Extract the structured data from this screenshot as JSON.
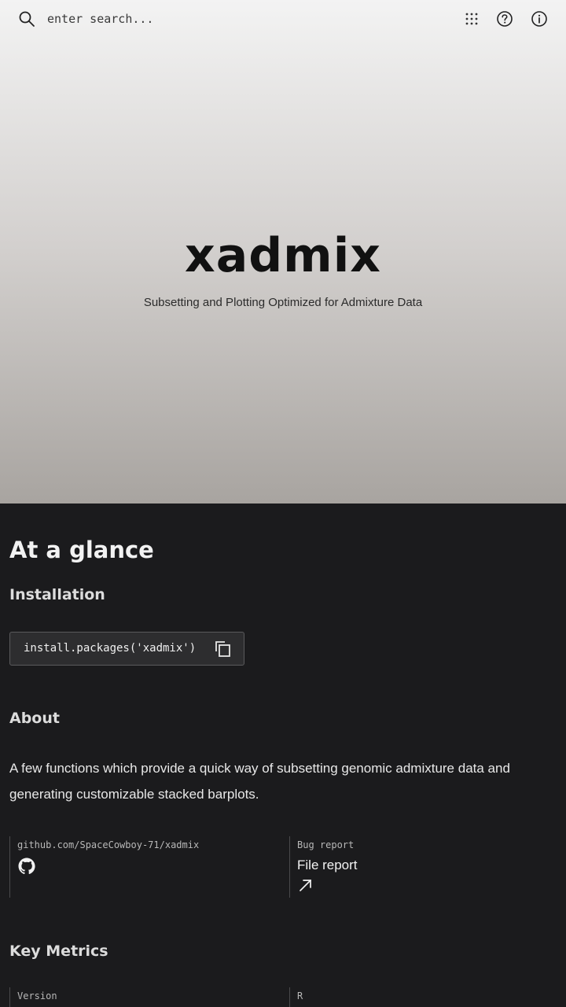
{
  "search": {
    "placeholder": "enter search..."
  },
  "header_icons": [
    "search-icon",
    "apps-grid-icon",
    "help-icon",
    "info-icon"
  ],
  "hero": {
    "title": "xadmix",
    "subtitle": "Subsetting and Plotting Optimized for Admixture Data"
  },
  "glance": {
    "heading": "At a glance",
    "installation": {
      "heading": "Installation",
      "code": "install.packages('xadmix')",
      "icon": "copy-icon"
    },
    "about": {
      "heading": "About",
      "text": "A few functions which provide a quick way of subsetting genomic admixture data and generating customizable stacked barplots."
    },
    "links": {
      "repo_label": "github.com/SpaceCowboy-71/xadmix",
      "repo_icon": "github-icon",
      "bug_label": "Bug report",
      "bug_link": "File report",
      "bug_icon": "arrow-up-right-icon"
    },
    "metrics": {
      "heading": "Key Metrics",
      "version_label": "Version",
      "r_label": "R"
    }
  },
  "colors": {
    "dark_bg": "#1b1b1d",
    "hero_top": "#f3f3f3",
    "hero_bottom": "#a8a4a0"
  }
}
